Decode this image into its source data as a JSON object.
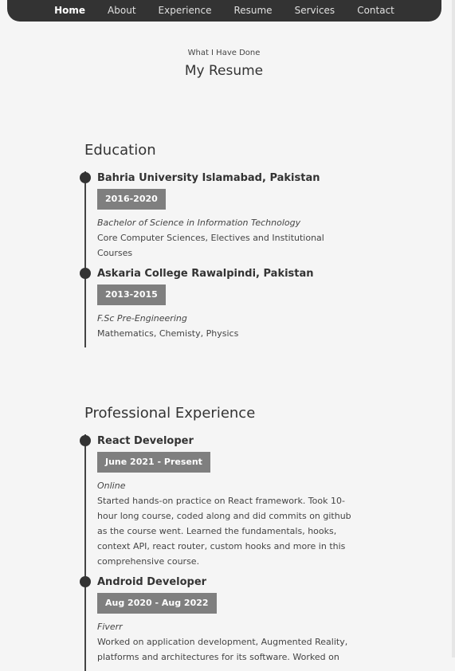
{
  "nav": {
    "items": [
      {
        "label": "Home",
        "active": true
      },
      {
        "label": "About",
        "active": false
      },
      {
        "label": "Experience",
        "active": false
      },
      {
        "label": "Resume",
        "active": false
      },
      {
        "label": "Services",
        "active": false
      },
      {
        "label": "Contact",
        "active": false
      }
    ]
  },
  "header": {
    "subtitle": "What I Have Done",
    "title": "My Resume"
  },
  "education": {
    "heading": "Education",
    "items": [
      {
        "title": "Bahria University Islamabad, Pakistan",
        "date": "2016-2020",
        "place": "Bachelor of Science in Information Technology",
        "desc": "Core Computer Sciences, Electives and Institutional Courses"
      },
      {
        "title": "Askaria College Rawalpindi, Pakistan",
        "date": "2013-2015",
        "place": "F.Sc Pre-Engineering",
        "desc": "Mathematics, Chemisty, Physics"
      }
    ]
  },
  "experience": {
    "heading": "Professional Experience",
    "items": [
      {
        "title": "React Developer",
        "date": "June 2021 - Present",
        "place": "Online",
        "desc": "Started hands-on practice on React framework. Took 10-hour long course, coded along and did commits on github as the course went. Learned the fundamentals, hooks, context API, react router, custom hooks and more in this comprehensive course."
      },
      {
        "title": "Android Developer",
        "date": "Aug 2020 - Aug 2022",
        "place": "Fiverr",
        "desc": "Worked on application development, Augmented Reality, platforms and architectures for its software. Worked on"
      }
    ]
  }
}
